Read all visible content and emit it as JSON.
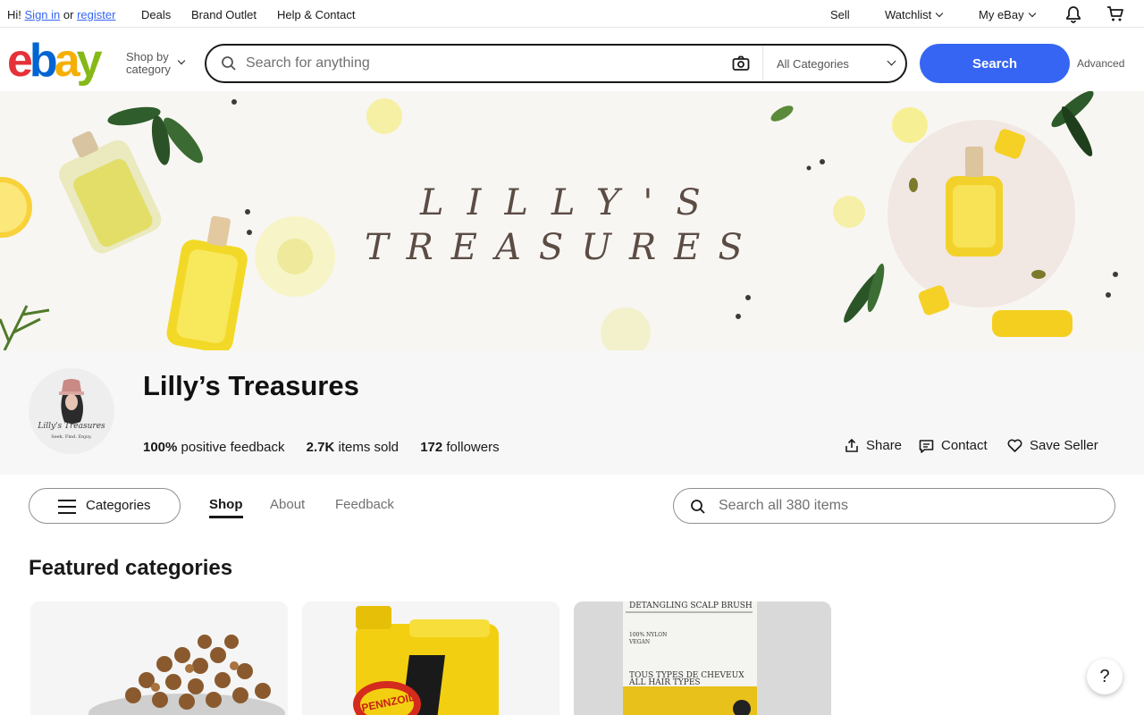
{
  "topbar": {
    "greeting_prefix": "Hi!",
    "sign_in": "Sign in",
    "or": "or",
    "register": "register",
    "deals": "Deals",
    "brand_outlet": "Brand Outlet",
    "help_contact": "Help & Contact",
    "sell": "Sell",
    "watchlist": "Watchlist",
    "my_ebay": "My eBay",
    "icons": [
      "bell-icon",
      "cart-icon"
    ]
  },
  "header": {
    "logo": [
      "e",
      "b",
      "a",
      "y"
    ],
    "logo_colors": [
      "#e53238",
      "#0064d2",
      "#f5af02",
      "#86b817"
    ],
    "shop_by_line1": "Shop by",
    "shop_by_line2": "category",
    "search_placeholder": "Search for anything",
    "category_select": "All Categories",
    "search_button": "Search",
    "advanced": "Advanced",
    "accent": "#3665f3"
  },
  "banner": {
    "line1": "LILLY'S",
    "line2": "TREASURES"
  },
  "store": {
    "name": "Lilly’s Treasures",
    "avatar_label": "Lilly's Treasures",
    "avatar_tagline": "Seek. Find. Enjoy.",
    "feedback_value": "100%",
    "feedback_label": "positive feedback",
    "sold_value": "2.7K",
    "sold_label": "items sold",
    "followers_value": "172",
    "followers_label": "followers",
    "share": "Share",
    "contact": "Contact",
    "save_seller": "Save Seller"
  },
  "nav": {
    "categories": "Categories",
    "tabs": [
      "Shop",
      "About",
      "Feedback"
    ],
    "active_tab": "Shop",
    "store_search_placeholder": "Search all 380 items"
  },
  "featured": {
    "title": "Featured categories",
    "cards": [
      {
        "image": "pet-food-bowl"
      },
      {
        "image": "pennzoil-oil-jug",
        "brand_text": "PENNZOIL"
      },
      {
        "image": "hair-brush-package",
        "text_line1": "DETANGLING SCALP BRUSH",
        "text_line2": "100% NYLON",
        "text_line3": "VEGAN",
        "text_line4": "TOUS TYPES DE CHEVEUX",
        "text_line5": "ALL HAIR TYPES"
      }
    ]
  },
  "help": {
    "label": "?"
  }
}
